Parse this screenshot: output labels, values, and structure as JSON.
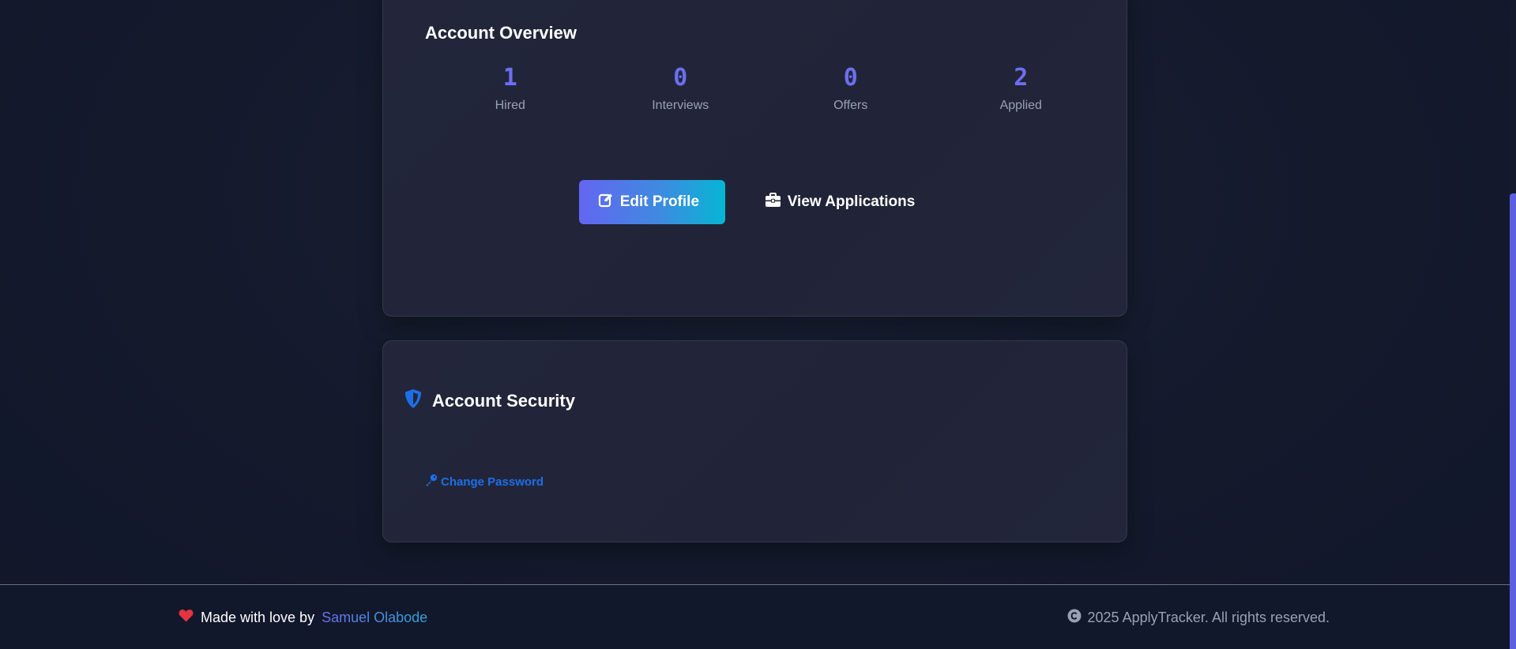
{
  "overview": {
    "title": "Account Overview",
    "stats": [
      {
        "value": "1",
        "label": "Hired"
      },
      {
        "value": "0",
        "label": "Interviews"
      },
      {
        "value": "0",
        "label": "Offers"
      },
      {
        "value": "2",
        "label": "Applied"
      }
    ],
    "edit_profile_label": "Edit Profile",
    "view_applications_label": "View Applications"
  },
  "security": {
    "title": "Account Security",
    "change_password_label": "Change Password"
  },
  "footer": {
    "made_with_love": "Made with love by",
    "author": "Samuel Olabode",
    "copyright": "2025 ApplyTracker. All rights reserved."
  },
  "icons": {
    "edit": "pen-to-square-icon",
    "applications": "briefcase-icon",
    "security": "shield-icon",
    "password": "key-icon",
    "love": "heart-icon",
    "copyright": "copyright-icon"
  },
  "colors": {
    "accent": "#6366f1",
    "accent_end": "#06b6d4",
    "link": "#1d6fe8",
    "heart": "#e3343f",
    "background": "#141a2c",
    "card": "#23263a"
  }
}
